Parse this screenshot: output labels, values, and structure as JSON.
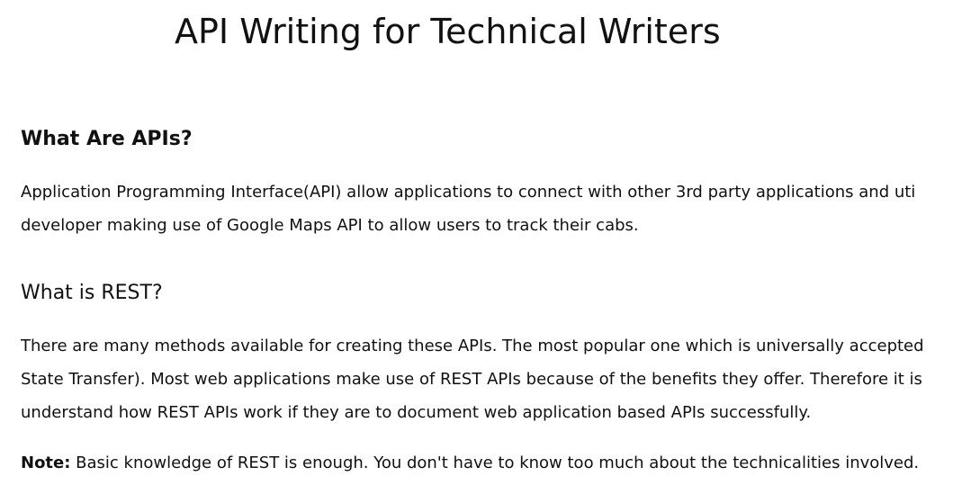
{
  "document": {
    "title": "API Writing for Technical Writers",
    "sections": [
      {
        "heading": "What Are APIs?",
        "paragraph_lines": [
          "Application Programming Interface(API) allow applications to connect with other 3rd party applications and uti",
          "developer making use of Google Maps API to allow users to track their cabs."
        ]
      },
      {
        "heading": "What is REST?",
        "paragraph_lines": [
          "There are many methods available for creating these APIs. The most popular one which is universally accepted",
          "State Transfer). Most web applications make use of REST APIs because of the benefits they offer. Therefore it is",
          "understand how REST APIs work if they are to document web application based APIs successfully."
        ],
        "note": {
          "label": "Note:",
          "text": " Basic knowledge of REST is enough. You don't have to know too much about the technicalities involved."
        }
      }
    ]
  }
}
